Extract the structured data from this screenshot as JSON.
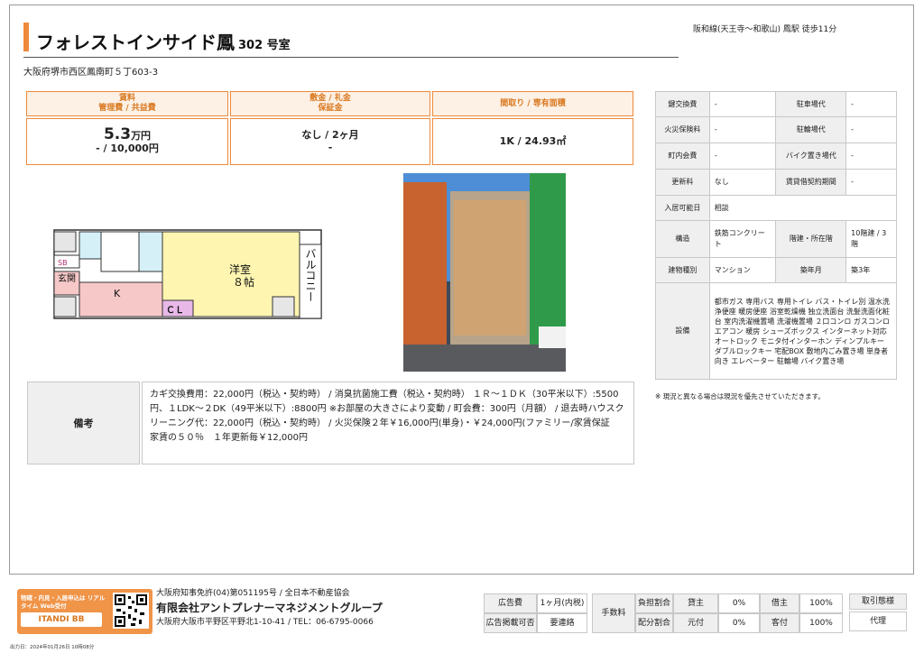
{
  "header": {
    "name": "フォレストインサイド鳳",
    "room": "302 号室",
    "station": "阪和線(天王寺～和歌山) 鳳駅 徒歩11分",
    "address": "大阪府堺市西区鳳南町５丁603-3"
  },
  "price": {
    "col1_head1": "賃料",
    "col1_head2": "管理費 / 共益費",
    "rent": "5.3",
    "rent_unit": "万円",
    "mgmt_fee": "- / 10,000円",
    "col2_head1": "敷金 / 礼金",
    "col2_head2": "保証金",
    "deposit_key": "なし / 2ヶ月",
    "guarantee": "-",
    "col3_head": "間取り / 専有面積",
    "layout_area": "1K / 24.93㎡"
  },
  "floorplan": {
    "sb": "SB",
    "entrance": "玄関",
    "kitchen": "K",
    "room": "洋室",
    "room_size": "８帖",
    "closet": "ＣＬ",
    "balcony": "バルコニー"
  },
  "info": {
    "key_exchange_lbl": "鍵交換費",
    "key_exchange": "-",
    "parking_lbl": "駐車場代",
    "parking": "-",
    "fire_ins_lbl": "火災保険料",
    "fire_ins": "-",
    "bicycle_lbl": "駐輪場代",
    "bicycle": "-",
    "town_fee_lbl": "町内会費",
    "town_fee": "-",
    "bike_lbl": "バイク置き場代",
    "bike": "-",
    "renewal_lbl": "更新料",
    "renewal": "なし",
    "lease_period_lbl": "賃貸借契約期間",
    "lease_period": "-",
    "move_in_lbl": "入居可能日",
    "move_in": "相談",
    "structure_lbl": "構造",
    "structure": "鉄筋コンクリート",
    "floors_lbl": "階建・所在階",
    "floors": "10階建 / 3階",
    "type_lbl": "建物種別",
    "type": "マンション",
    "age_lbl": "築年月",
    "age": "築3年",
    "equip_lbl": "設備",
    "equipment": "都市ガス 専用バス 専用トイレ バス・トイレ別 温水洗浄便座 暖房便座 浴室乾燥機 独立洗面台 洗髪洗面化粧台 室内洗濯機置場 洗濯機置場 ２口コンロ ガスコンロ エアコン 暖房 シューズボックス インターネット対応 オートロック モニタ付インターホン ディンプルキー ダブルロックキー 宅配BOX 敷地内ごみ置き場 単身者向き エレベーター 駐輪場 バイク置き場",
    "note": "※ 現況と異なる場合は現況を優先させていただきます。"
  },
  "remarks": {
    "label": "備考",
    "text": "カギ交換費用：22,000円（税込・契約時） / 消臭抗菌施工費（税込・契約時） １Ｒ～１ＤＫ（30平米以下）:5500円、１LDK～２DK（49平米以下）:8800円 ※お部屋の大きさにより変動 / 町会費：300円（月額） / 退去時ハウスクリーニング代：22,000円（税込・契約時） / 火災保険２年￥16,000円(単身)・￥24,000円(ファミリー/家賃保証　家賃の５０％　１年更新毎￥12,000円"
  },
  "footer": {
    "banner_text": "物確・内見・入居申込は リアルタイム Web受付",
    "banner_logo": "ITANDI BB",
    "license": "大阪府知事免許(04)第051195号 / 全日本不動産協会",
    "company": "有限会社アントプレナーマネジメントグループ",
    "company_address": "大阪府大阪市平野区平野北1-10-41 / TEL：06-6795-0066",
    "ad_fee_lbl": "広告費",
    "ad_fee": "1ヶ月(内税)",
    "ad_ok_lbl": "広告掲載可否",
    "ad_ok": "要連絡",
    "commission_lbl": "手数料",
    "burden_lbl": "負担割合",
    "lessor_lbl": "貸主",
    "lessor": "0%",
    "tenant_lbl": "借主",
    "tenant": "100%",
    "split_lbl": "配分割合",
    "origin_lbl": "元付",
    "origin": "0%",
    "client_lbl": "客付",
    "client": "100%",
    "deal_type_lbl": "取引態様",
    "deal_type": "代理",
    "printed": "出力日：2024年01月26日 10時08分"
  },
  "colors": {
    "accent": "#ee8a3c",
    "header_bg": "#fdf0e4",
    "label_bg": "#efefef"
  }
}
